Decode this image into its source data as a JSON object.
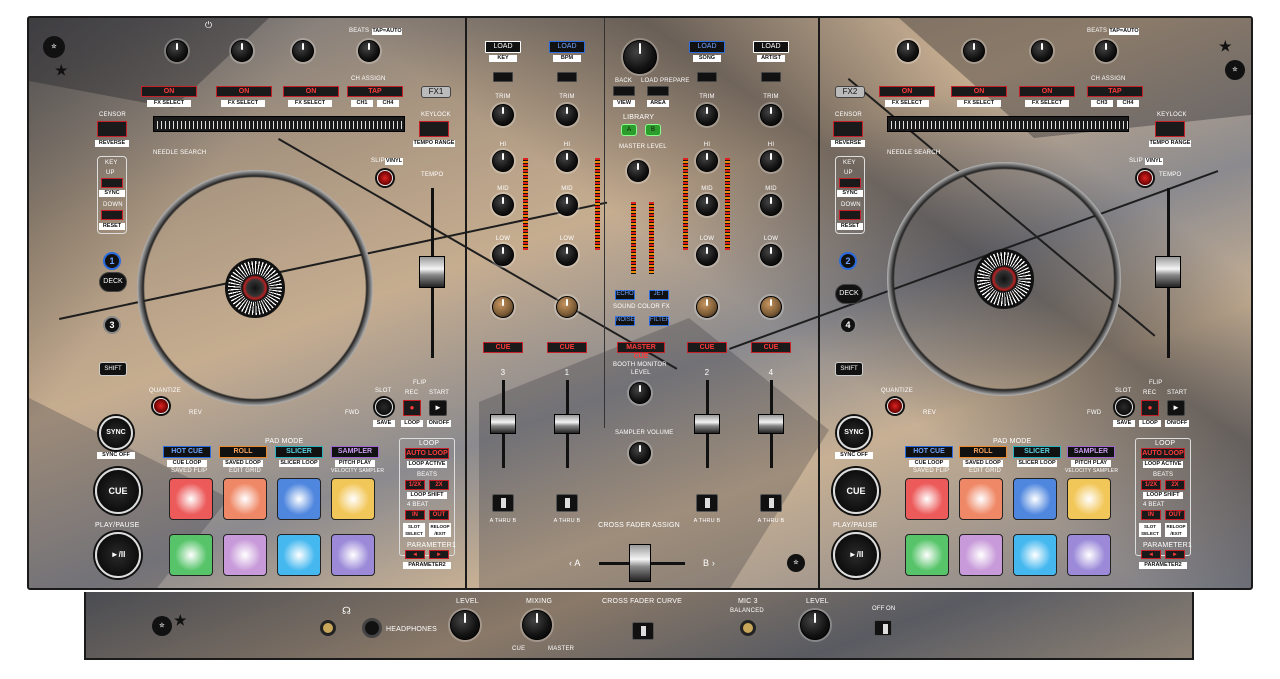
{
  "colors": {
    "accent_red": "#c4202a",
    "blue": "#2a6be0",
    "green": "#29b629"
  },
  "icons": [
    "power-icon",
    "headphones-icon",
    "star-logo-icon"
  ],
  "deck_left": {
    "beats_label": "BEATS",
    "tap_auto": "TAP=AUTO",
    "ch_assign": "CH ASSIGN",
    "fx_on_labels": [
      "ON",
      "ON",
      "ON"
    ],
    "fx_select": "FX SELECT",
    "tap": "TAP",
    "ch_buttons": [
      "CH1",
      "CH4"
    ],
    "fx_badge": "FX1",
    "censor": "CENSOR",
    "reverse": "REVERSE",
    "keylock": "KEYLOCK",
    "tempo_range": "TEMPO RANGE",
    "needle_search": "NEEDLE SEARCH",
    "key": "KEY",
    "up": "UP",
    "sync_small": "SYNC",
    "down": "DOWN",
    "reset": "RESET",
    "slip": "SLIP",
    "vinyl": "VINYL",
    "tempo": "TEMPO",
    "deck": "DECK",
    "deck_nums": [
      "1",
      "3"
    ],
    "shift": "SHIFT",
    "quantize": "QUANTIZE",
    "rev": "REV",
    "fwd": "FWD",
    "slot": "SLOT",
    "save": "SAVE",
    "flip": "FLIP",
    "rec": "REC",
    "start": "START",
    "loop": "LOOP",
    "on_off": "ON/OFF",
    "sync": "SYNC",
    "sync_off": "SYNC OFF",
    "cue": "CUE",
    "play_pause": "PLAY/PAUSE",
    "play_glyph": "►/II",
    "pad_mode": "PAD MODE",
    "modes": [
      {
        "label": "HOT CUE",
        "sub": "CUE LOOP",
        "sub2": "SAVED FLIP",
        "color": "#2a6be0"
      },
      {
        "label": "ROLL",
        "sub": "SAVED LOOP",
        "sub2": "EDIT GRID",
        "color": "#e8882a"
      },
      {
        "label": "SLICER",
        "sub": "SLICER LOOP",
        "sub2": "",
        "color": "#2ab0c0"
      },
      {
        "label": "SAMPLER",
        "sub": "PITCH PLAY",
        "sub2": "VELOCITY SAMPLER",
        "color": "#a066d0"
      }
    ],
    "pads": [
      "#ec5a5a",
      "#ef8866",
      "#4f86de",
      "#f2c75a",
      "#57c46a",
      "#c89ad9",
      "#45b8ef",
      "#9c8ad9"
    ],
    "loop_title": "LOOP",
    "auto_loop": "AUTO LOOP",
    "loop_active": "LOOP ACTIVE",
    "beats_small": "BEATS",
    "half": "1/2X",
    "double": "2X",
    "loop_shift": "LOOP SHIFT",
    "four_beat": "4 BEAT",
    "in": "IN",
    "out": "OUT",
    "slot_select": "SLOT SELECT",
    "reloop_exit": "RELOOP /EXIT",
    "parameter1": "PARAMETER1",
    "parameter2": "PARAMETER2"
  },
  "deck_right": {
    "fx_badge": "FX2",
    "deck_nums": [
      "2",
      "4"
    ],
    "ch_buttons": [
      "CH3",
      "CH4"
    ]
  },
  "mixer": {
    "load": "LOAD",
    "key": "KEY",
    "bpm": "BPM",
    "song": "SONG",
    "artist": "ARTIST",
    "trim": "TRIM",
    "hi": "HI",
    "mid": "MID",
    "low": "LOW",
    "cue": "CUE",
    "channels": [
      "3",
      "1",
      "2",
      "4"
    ],
    "back": "BACK",
    "load_prepare": "LOAD PREPARE",
    "view": "VIEW",
    "area": "AREA",
    "library": "LIBRARY",
    "a_btn": "A",
    "b_btn": "B",
    "master_level": "MASTER LEVEL",
    "echo": "ECHO",
    "jet": "JET",
    "sound_color_fx": "SOUND COLOR FX",
    "noise": "NOISE",
    "filter": "FILTER",
    "master_cue": "MASTER CUE",
    "booth_monitor": "BOOTH MONITOR",
    "level": "LEVEL",
    "sampler_volume": "SAMPLER VOLUME",
    "crossfader_assign": "CROSS FADER ASSIGN",
    "athru_b": "A THRU B",
    "a_side": "A",
    "b_side": "B"
  },
  "front": {
    "headphones": "HEADPHONES",
    "level": "LEVEL",
    "mixing": "MIXING",
    "cue": "CUE",
    "master": "MASTER",
    "crossfader_curve": "CROSS FADER CURVE",
    "mic": "MIC 3",
    "balanced": "BALANCED",
    "mic_level": "LEVEL",
    "off": "OFF",
    "on": "ON"
  }
}
